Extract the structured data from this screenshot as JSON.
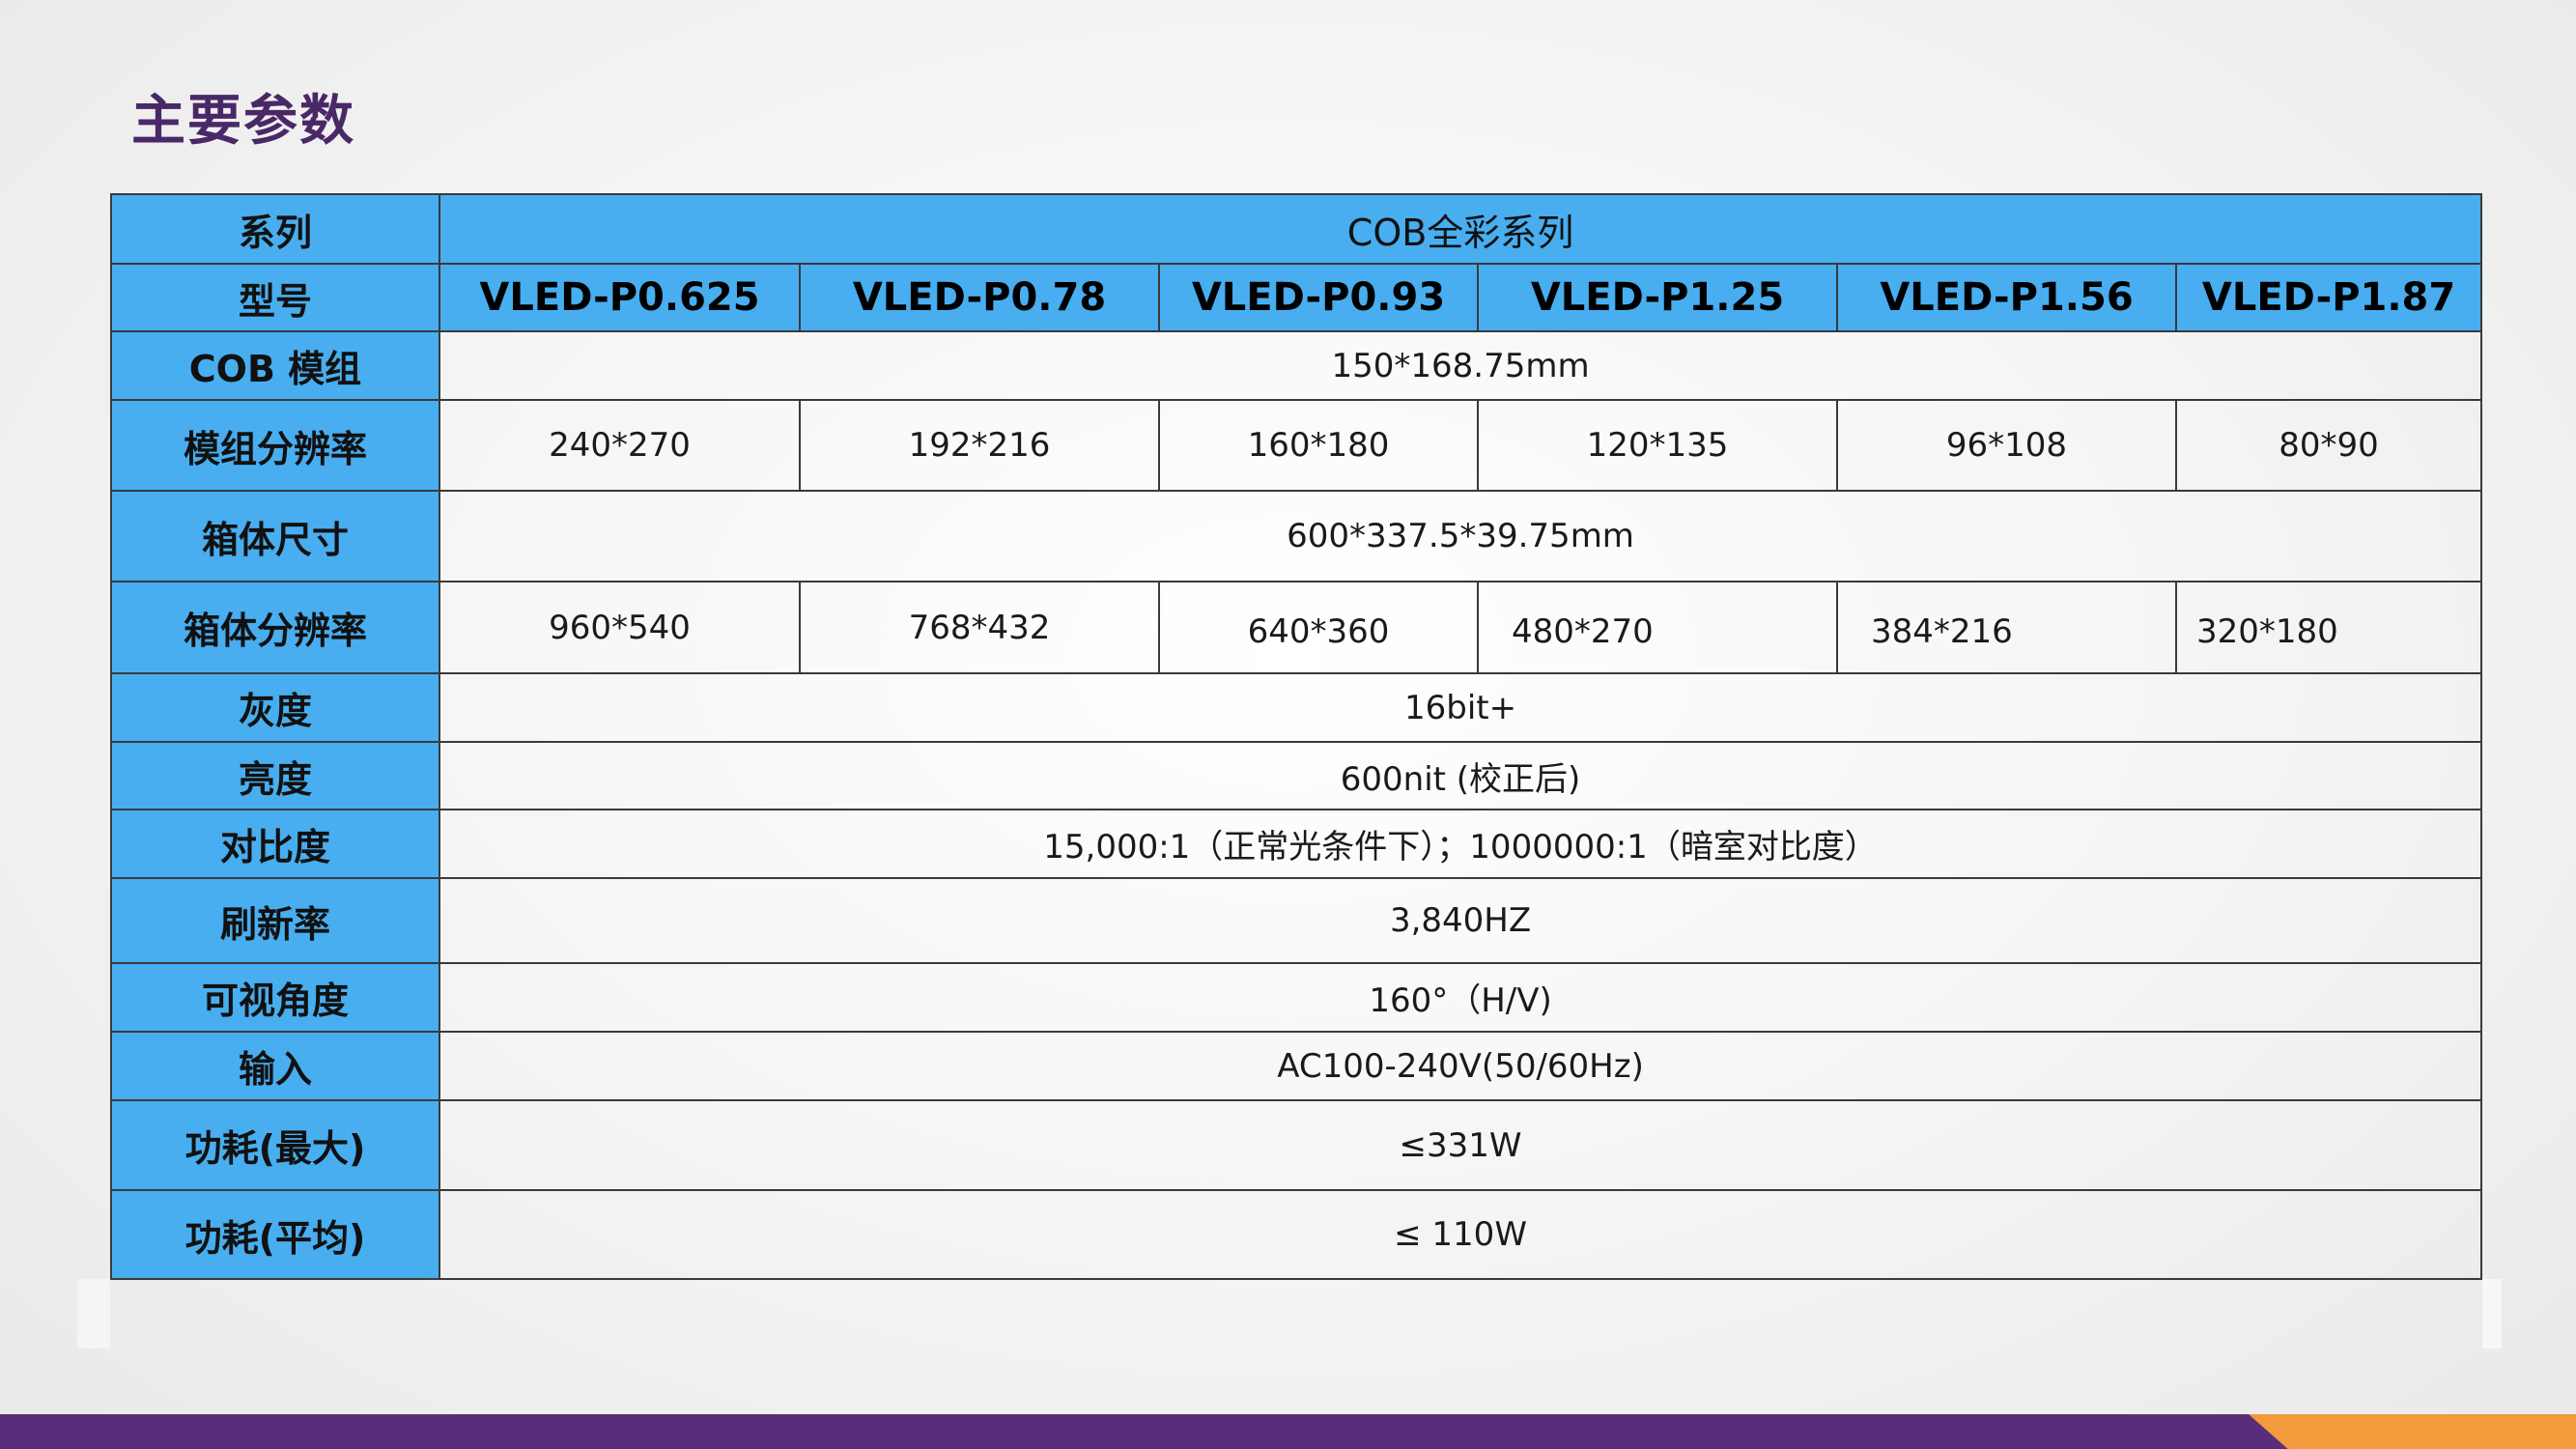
{
  "title": "主要参数",
  "table": {
    "series": {
      "label": "系列",
      "value": "COB全彩系列"
    },
    "model": {
      "label": "型号",
      "values": [
        "VLED-P0.625",
        "VLED-P0.78",
        "VLED-P0.93",
        "VLED-P1.25",
        "VLED-P1.56",
        "VLED-P1.87"
      ]
    },
    "cob_module": {
      "label": "COB 模组",
      "value": "150*168.75mm"
    },
    "module_resolution": {
      "label": "模组分辨率",
      "values": [
        "240*270",
        "192*216",
        "160*180",
        "120*135",
        "96*108",
        "80*90"
      ]
    },
    "cabinet_size": {
      "label": "箱体尺寸",
      "value": "600*337.5*39.75mm"
    },
    "cabinet_resolution": {
      "label": "箱体分辨率",
      "values": [
        "960*540",
        "768*432",
        "640*360",
        "480*270",
        "384*216",
        "320*180"
      ]
    },
    "grayscale": {
      "label": "灰度",
      "value": "16bit+"
    },
    "brightness": {
      "label": "亮度",
      "value": "600nit (校正后)"
    },
    "contrast": {
      "label": "对比度",
      "value": "15,000:1（正常光条件下）；1000000:1（暗室对比度）"
    },
    "refresh_rate": {
      "label": "刷新率",
      "value": "3,840HZ"
    },
    "viewing_angle": {
      "label": "可视角度",
      "value": "160°（H/V)"
    },
    "input": {
      "label": "输入",
      "value": "AC100-240V(50/60Hz)"
    },
    "power_max": {
      "label": "功耗(最大)",
      "value": "≤331W"
    },
    "power_avg": {
      "label": "功耗(平均)",
      "value": "≤ 110W"
    }
  },
  "colors": {
    "header_blue": "#48aef0",
    "title_purple": "#4a2868",
    "footer_purple": "#5a2d7a",
    "footer_orange": "#f39a3c"
  }
}
